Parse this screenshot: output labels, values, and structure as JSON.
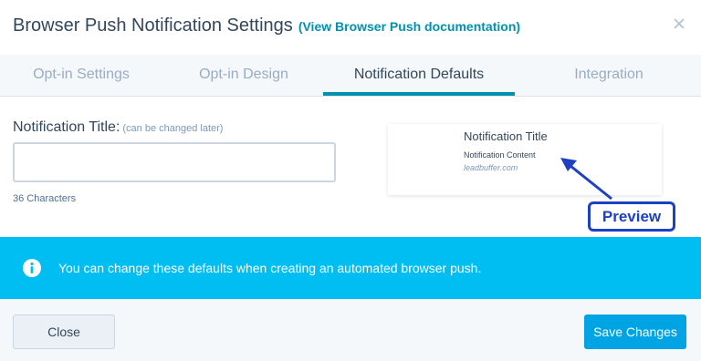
{
  "header": {
    "title": "Browser Push Notification Settings",
    "doc_link": "(View Browser Push documentation)",
    "close_icon": "close-icon"
  },
  "tabs": [
    {
      "label": "Opt-in Settings",
      "active": false
    },
    {
      "label": "Opt-in Design",
      "active": false
    },
    {
      "label": "Notification Defaults",
      "active": true
    },
    {
      "label": "Integration",
      "active": false
    }
  ],
  "form": {
    "label": "Notification Title:",
    "hint": "(can be changed later)",
    "value": "",
    "char_count": "36 Characters"
  },
  "preview": {
    "title": "Notification Title",
    "content": "Notification Content",
    "domain": "leadbuffer.com",
    "badge": "Preview"
  },
  "banner": {
    "icon": "info-icon",
    "text": "You can change these defaults when creating an automated browser push."
  },
  "footer": {
    "close_label": "Close",
    "save_label": "Save Changes"
  },
  "colors": {
    "accent": "#0091ae",
    "banner": "#00bdf2",
    "primary_button": "#00a4e4",
    "annotation": "#1e40c4"
  }
}
